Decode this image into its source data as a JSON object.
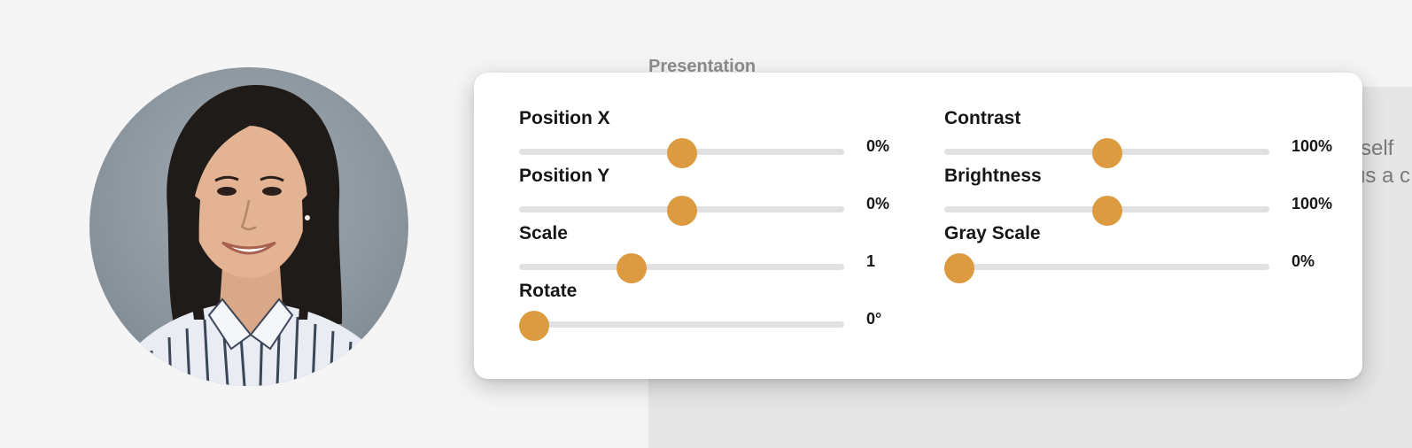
{
  "background": {
    "section_title": "Presentation",
    "text_line_1": "rself",
    "text_line_2": "us a c"
  },
  "avatar": {
    "description_icon": "portrait-photo"
  },
  "editor": {
    "accent_color": "#dc9a41",
    "left_controls": [
      {
        "label": "Position X",
        "value": "0%",
        "level": 0.5
      },
      {
        "label": "Position Y",
        "value": "0%",
        "level": 0.5
      },
      {
        "label": "Scale",
        "value": "1",
        "level": 0.33
      },
      {
        "label": "Rotate",
        "value": "0°",
        "level": 0.0
      }
    ],
    "right_controls": [
      {
        "label": "Contrast",
        "value": "100%",
        "level": 0.5
      },
      {
        "label": "Brightness",
        "value": "100%",
        "level": 0.5
      },
      {
        "label": "Gray Scale",
        "value": "0%",
        "level": 0.0
      }
    ]
  }
}
